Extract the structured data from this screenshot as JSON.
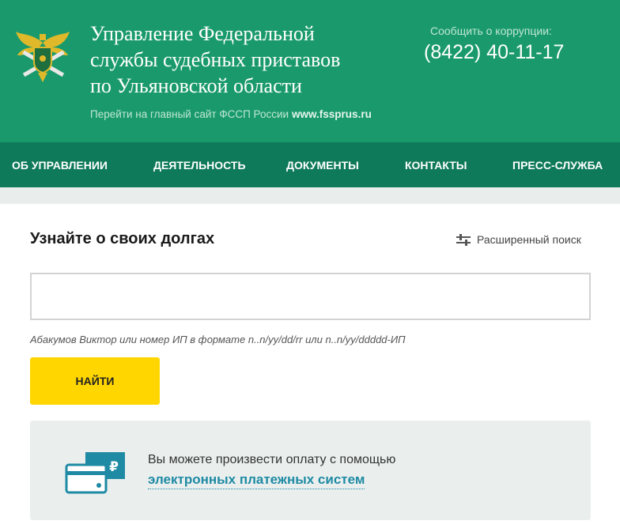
{
  "header": {
    "title_lines": [
      "Управление Федеральной",
      "службы судебных приставов",
      "по Ульяновской области"
    ],
    "main_site_text": "Перейти на главный сайт ФССП России",
    "main_site_domain": "www.fssprus.ru",
    "corruption_label": "Сообщить о коррупции:",
    "corruption_phone": "(8422) 40-11-17",
    "emblem_icon": "fssp-emblem-icon"
  },
  "nav": {
    "items": [
      "ОБ УПРАВЛЕНИИ",
      "ДЕЯТЕЛЬНОСТЬ",
      "ДОКУМЕНТЫ",
      "КОНТАКТЫ",
      "ПРЕСС-СЛУЖБА"
    ]
  },
  "search": {
    "title": "Узнайте о своих долгах",
    "advanced_label": "Расширенный поиск",
    "input_value": "",
    "hint": "Абакумов Виктор или номер ИП в формате n..n/yy/dd/rr или n..n/yy/ddddd-ИП",
    "button_label": "НАЙТИ"
  },
  "payment": {
    "text": "Вы можете произвести оплату с помощью",
    "link": "электронных платежных систем",
    "icon": "card-payment-icon"
  },
  "colors": {
    "header_bg": "#1a9a6c",
    "nav_bg": "#0f7a5a",
    "button_bg": "#ffd600",
    "link": "#1e8aa3"
  }
}
